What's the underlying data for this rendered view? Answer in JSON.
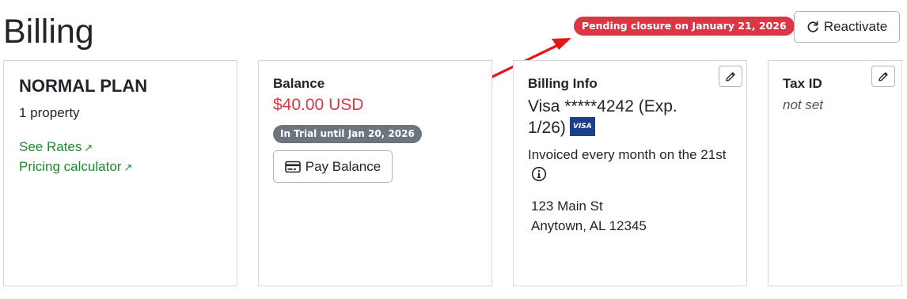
{
  "page": {
    "title": "Billing"
  },
  "header": {
    "status_badge": "Pending closure on January 21, 2026",
    "reactivate_label": "Reactivate"
  },
  "plan": {
    "name": "NORMAL PLAN",
    "properties": "1 property",
    "links": [
      {
        "label": "See Rates",
        "icon": "external-link-icon"
      },
      {
        "label": "Pricing calculator",
        "icon": "external-link-icon"
      }
    ]
  },
  "balance": {
    "label": "Balance",
    "amount": "$40.00 USD",
    "trial_badge": "In Trial until Jan 20, 2026",
    "pay_label": "Pay Balance"
  },
  "billing_info": {
    "label": "Billing Info",
    "card": "Visa *****4242 (Exp. 1/26)",
    "card_brand": "VISA",
    "invoiced": "Invoiced every month on the 21st",
    "address_line1": "123 Main St",
    "address_line2": "Anytown, AL 12345"
  },
  "tax": {
    "label": "Tax ID",
    "value": "not set"
  },
  "colors": {
    "danger": "#dc3545",
    "link": "#1e8a2e",
    "muted_badge": "#6c757d",
    "visa_blue": "#1a3f8f"
  }
}
